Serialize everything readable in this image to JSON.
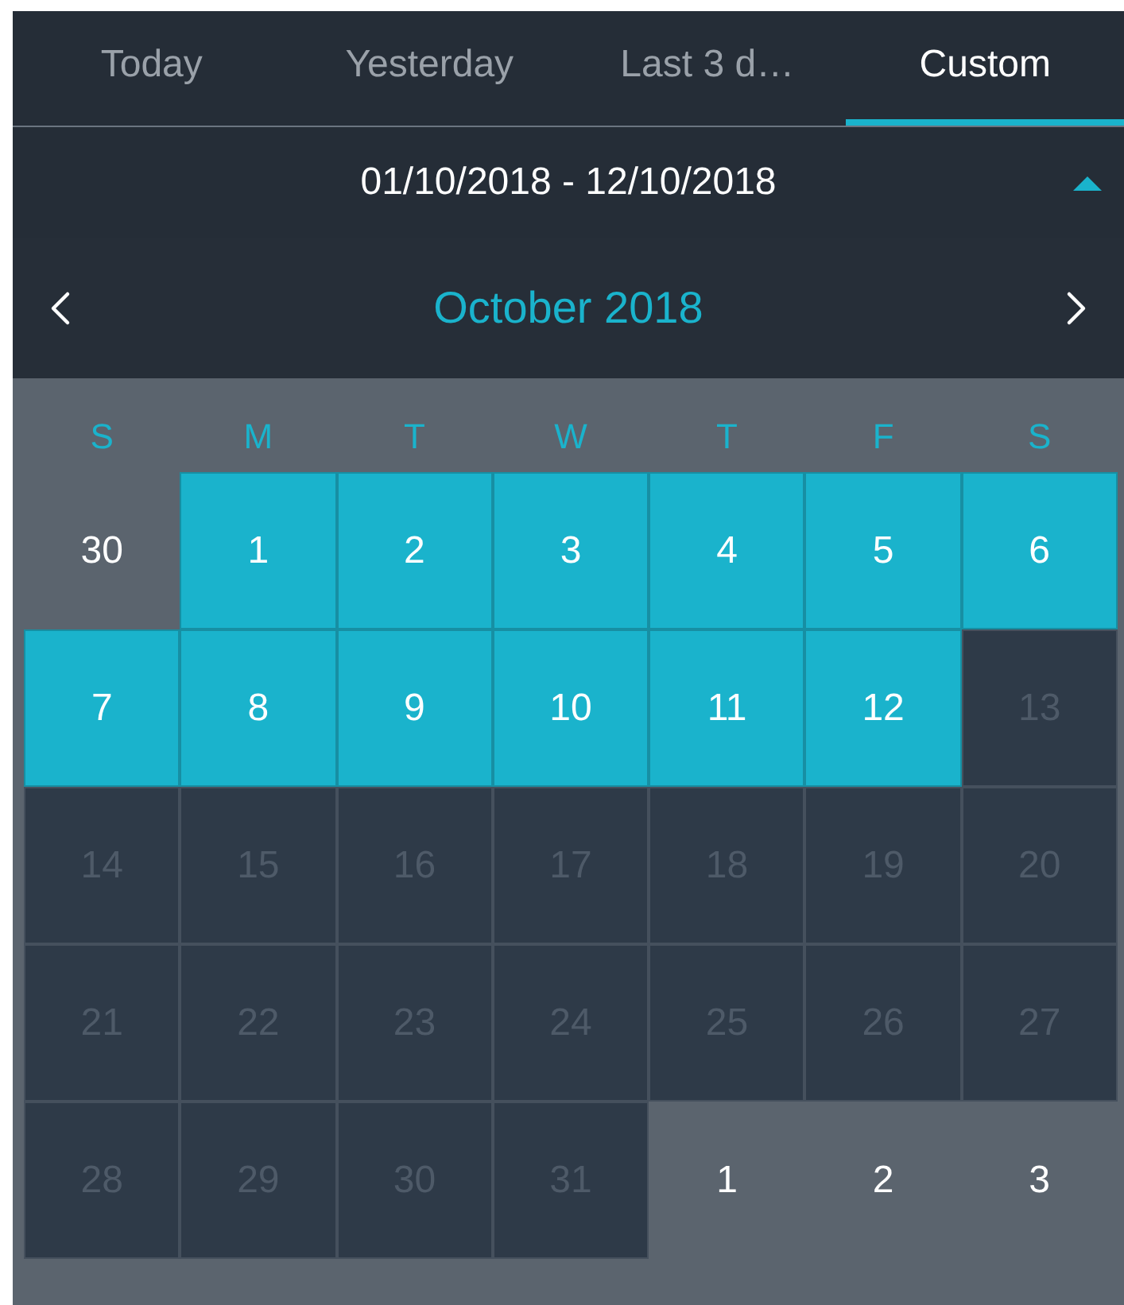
{
  "tabs": [
    {
      "label": "Today",
      "selected": false
    },
    {
      "label": "Yesterday",
      "selected": false
    },
    {
      "label": "Last 3 d…",
      "selected": false
    },
    {
      "label": "Custom",
      "selected": true
    }
  ],
  "date_range": {
    "text": "01/10/2018 - 12/10/2018",
    "expanded": true
  },
  "calendar": {
    "month": "October 2018",
    "weekdays": [
      "S",
      "M",
      "T",
      "W",
      "T",
      "F",
      "S"
    ],
    "weeks": [
      [
        {
          "label": "30",
          "kind": "outside"
        },
        {
          "label": "1",
          "kind": "day",
          "selected": true
        },
        {
          "label": "2",
          "kind": "day",
          "selected": true
        },
        {
          "label": "3",
          "kind": "day",
          "selected": true
        },
        {
          "label": "4",
          "kind": "day",
          "selected": true
        },
        {
          "label": "5",
          "kind": "day",
          "selected": true
        },
        {
          "label": "6",
          "kind": "day",
          "selected": true
        }
      ],
      [
        {
          "label": "7",
          "kind": "day",
          "selected": true
        },
        {
          "label": "8",
          "kind": "day",
          "selected": true
        },
        {
          "label": "9",
          "kind": "day",
          "selected": true
        },
        {
          "label": "10",
          "kind": "day",
          "selected": true
        },
        {
          "label": "11",
          "kind": "day",
          "selected": true
        },
        {
          "label": "12",
          "kind": "day",
          "selected": true
        },
        {
          "label": "13",
          "kind": "day",
          "selected": false
        }
      ],
      [
        {
          "label": "14",
          "kind": "day",
          "selected": false
        },
        {
          "label": "15",
          "kind": "day",
          "selected": false
        },
        {
          "label": "16",
          "kind": "day",
          "selected": false
        },
        {
          "label": "17",
          "kind": "day",
          "selected": false
        },
        {
          "label": "18",
          "kind": "day",
          "selected": false
        },
        {
          "label": "19",
          "kind": "day",
          "selected": false
        },
        {
          "label": "20",
          "kind": "day",
          "selected": false
        }
      ],
      [
        {
          "label": "21",
          "kind": "day",
          "selected": false
        },
        {
          "label": "22",
          "kind": "day",
          "selected": false
        },
        {
          "label": "23",
          "kind": "day",
          "selected": false
        },
        {
          "label": "24",
          "kind": "day",
          "selected": false
        },
        {
          "label": "25",
          "kind": "day",
          "selected": false
        },
        {
          "label": "26",
          "kind": "day",
          "selected": false
        },
        {
          "label": "27",
          "kind": "day",
          "selected": false
        }
      ],
      [
        {
          "label": "28",
          "kind": "day",
          "selected": false
        },
        {
          "label": "29",
          "kind": "day",
          "selected": false
        },
        {
          "label": "30",
          "kind": "day",
          "selected": false
        },
        {
          "label": "31",
          "kind": "day",
          "selected": false
        },
        {
          "label": "1",
          "kind": "outside"
        },
        {
          "label": "2",
          "kind": "outside"
        },
        {
          "label": "3",
          "kind": "outside"
        }
      ]
    ]
  }
}
